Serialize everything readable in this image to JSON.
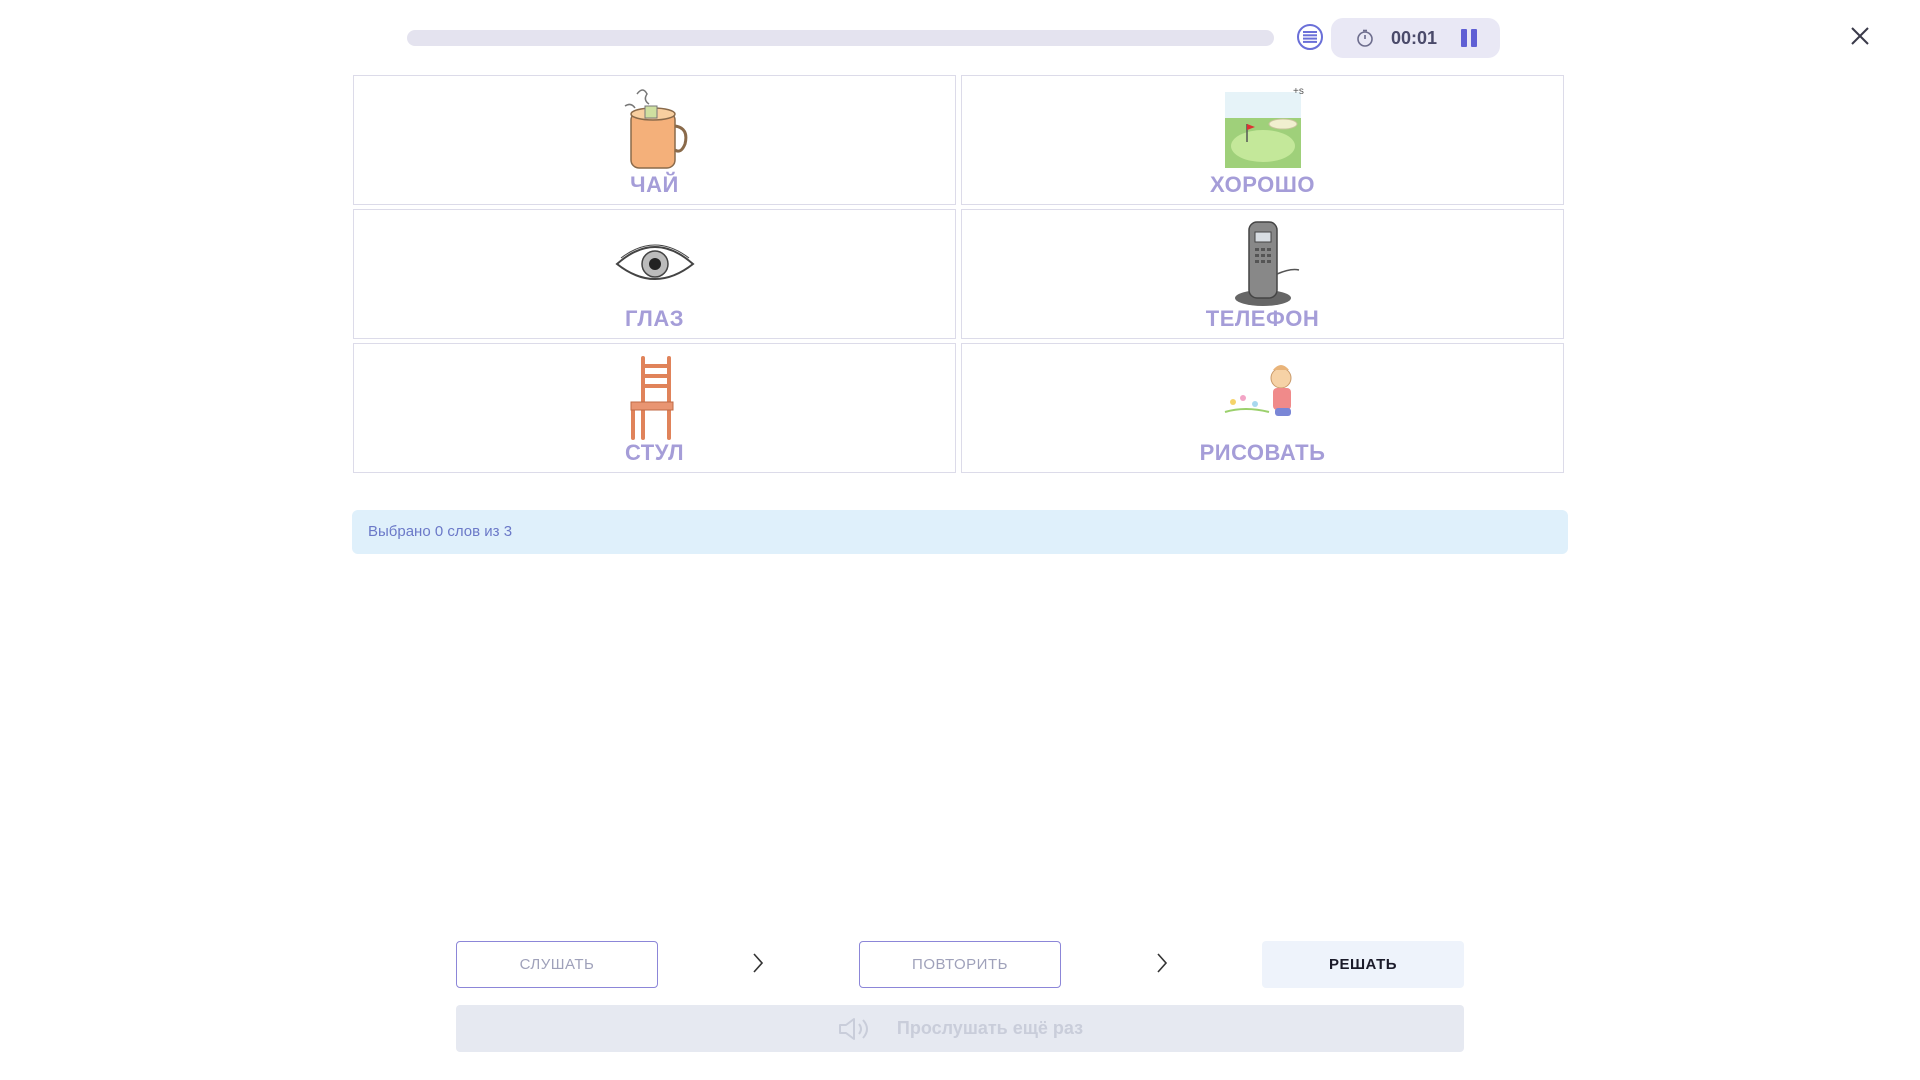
{
  "header": {
    "progress": 0,
    "timer": "00:01"
  },
  "cards": [
    {
      "word": "ЧАЙ",
      "icon": "tea-mug-image"
    },
    {
      "word": "ХОРОШО",
      "icon": "golf-green-image"
    },
    {
      "word": "ГЛАЗ",
      "icon": "eye-image"
    },
    {
      "word": "ТЕЛЕФОН",
      "icon": "cordless-phone-image"
    },
    {
      "word": "СТУЛ",
      "icon": "chair-image"
    },
    {
      "word": "РИСОВАТЬ",
      "icon": "child-drawing-image"
    }
  ],
  "status": {
    "text": "Выбрано 0 слов из 3"
  },
  "steps": {
    "listen": "СЛУШАТЬ",
    "repeat": "ПОВТОРИТЬ",
    "solve": "РЕШАТЬ"
  },
  "listen_again": {
    "label": "Прослушать ещё раз"
  },
  "colors": {
    "accent": "#7d72d6",
    "word": "#a59dd8",
    "status_bg": "#dff0fb"
  }
}
